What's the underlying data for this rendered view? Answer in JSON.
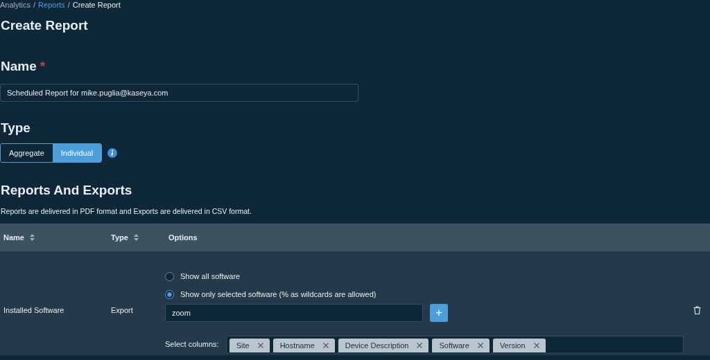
{
  "breadcrumb": [
    {
      "label": "Analytics",
      "link": false
    },
    {
      "label": "Reports",
      "link": true
    },
    {
      "label": "Create Report",
      "link": false
    }
  ],
  "breadcrumb_separator": "/",
  "title": "Create Report",
  "name_section": {
    "heading": "Name",
    "required_mark": "*",
    "value": "Scheduled Report for mike.puglia@kaseya.com"
  },
  "type_section": {
    "heading": "Type",
    "options": [
      {
        "label": "Aggregate",
        "selected": false
      },
      {
        "label": "Individual",
        "selected": true
      }
    ]
  },
  "reports_section": {
    "heading": "Reports And Exports",
    "description": "Reports are delivered in PDF format and Exports are delivered in CSV format."
  },
  "table": {
    "columns": [
      {
        "label": "Name",
        "sortable": true
      },
      {
        "label": "Type",
        "sortable": true
      },
      {
        "label": "Options",
        "sortable": false
      }
    ],
    "rows": [
      {
        "name": "Installed Software",
        "type": "Export",
        "radios": [
          {
            "label": "Show all software",
            "selected": false
          },
          {
            "label": "Show only selected software (% as wildcards are allowed)",
            "selected": true
          }
        ],
        "filter_value": "zoom",
        "add_label": "+",
        "columns_label": "Select columns:",
        "chips": [
          "Site",
          "Hostname",
          "Device Description",
          "Software",
          "Version"
        ]
      }
    ]
  }
}
